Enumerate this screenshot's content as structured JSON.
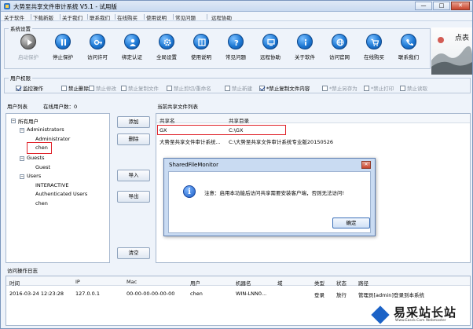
{
  "window": {
    "title": "大势至共享文件审计系统 V5.1 - 试用版",
    "min": "—",
    "max": "□",
    "close": "✕"
  },
  "menu": [
    "关于软件",
    "下载新版",
    "关于我们",
    "联系我们",
    "在线购买",
    "使用说明",
    "常见问题",
    "远程协助"
  ],
  "system": {
    "title": "系统设置",
    "buttons": [
      {
        "label": "启动保护",
        "icon": "play-icon",
        "disabled": true
      },
      {
        "label": "停止保护",
        "icon": "pause-icon",
        "disabled": false
      },
      {
        "label": "访问许可",
        "icon": "key-icon",
        "disabled": false
      },
      {
        "label": "绑定认证",
        "icon": "person-icon",
        "disabled": false
      },
      {
        "label": "全局设置",
        "icon": "gear-icon",
        "disabled": false
      },
      {
        "label": "使用说明",
        "icon": "book-icon",
        "disabled": false
      },
      {
        "label": "常见问题",
        "icon": "question-icon",
        "disabled": false
      },
      {
        "label": "远程协助",
        "icon": "remote-icon",
        "disabled": false
      },
      {
        "label": "关于软件",
        "icon": "info-icon",
        "disabled": false
      },
      {
        "label": "访问官网",
        "icon": "web-icon",
        "disabled": false
      },
      {
        "label": "在线购买",
        "icon": "cart-icon",
        "disabled": false
      },
      {
        "label": "联系我们",
        "icon": "contact-icon",
        "disabled": false
      }
    ],
    "logo_text": "点表"
  },
  "permissions": {
    "title": "用户权限",
    "items": [
      {
        "label": "监控操作",
        "checked": true,
        "enabled": true
      },
      {
        "label": "禁止删除",
        "checked": false,
        "enabled": true
      },
      {
        "label": "禁止修改",
        "checked": false,
        "enabled": false
      },
      {
        "label": "禁止复制文件",
        "checked": false,
        "enabled": false
      },
      {
        "label": "禁止剪切/重命名",
        "checked": false,
        "enabled": false
      },
      {
        "label": "禁止新建",
        "checked": false,
        "enabled": false
      },
      {
        "label": "*禁止复制文件内容",
        "checked": true,
        "enabled": true
      },
      {
        "label": "*禁止另存为",
        "checked": false,
        "enabled": false
      },
      {
        "label": "*禁止打印",
        "checked": false,
        "enabled": false
      },
      {
        "label": "禁止读取",
        "checked": false,
        "enabled": false
      }
    ]
  },
  "users": {
    "list_label": "用户列表",
    "count_label": "在线用户数：0",
    "tree": [
      {
        "label": "所有用户",
        "level": 0,
        "expander": "−"
      },
      {
        "label": "Administrators",
        "level": 1,
        "expander": "−"
      },
      {
        "label": "Administrator",
        "level": 2
      },
      {
        "label": "chen",
        "level": 2,
        "highlight": true
      },
      {
        "label": "Guests",
        "level": 1,
        "expander": "−"
      },
      {
        "label": "Guest",
        "level": 2
      },
      {
        "label": "Users",
        "level": 1,
        "expander": "−"
      },
      {
        "label": "INTERACTIVE",
        "level": 2
      },
      {
        "label": "Authenticated Users",
        "level": 2
      },
      {
        "label": "chen",
        "level": 2
      }
    ],
    "buttons": {
      "add": "添加",
      "delete": "删除",
      "import": "导入",
      "export": "导出",
      "clear": "清空"
    }
  },
  "shares": {
    "title": "当前共享文件列表",
    "headers": [
      "共享名",
      "共享目录"
    ],
    "rows": [
      [
        "GX",
        "C:\\GX"
      ],
      [
        "大势至共享文件审计系统...",
        "C:\\大势至共享文件审计系统专业版20150526"
      ]
    ]
  },
  "log": {
    "title": "访问操作日志",
    "headers": [
      "时间",
      "IP",
      "Mac",
      "用户",
      "机器名",
      "域",
      "类型",
      "状态",
      "路径"
    ],
    "rows": [
      [
        "2016-03-24 12:23:28",
        "127.0.0.1",
        "00-00-00-00-00-00",
        "chen",
        "WIN-LNN0...",
        "",
        "登录",
        "放行",
        "管理员[admin]登录到本系统"
      ]
    ]
  },
  "dialog": {
    "title": "SharedFileMonitor",
    "close": "✕",
    "message": "注意：启用本功能后访问共享需要安装客户端，否则无法访问!",
    "ok": "确定"
  },
  "watermark": {
    "text": "易采站长站",
    "sub": "Www.Easck.Com Webmaster"
  }
}
